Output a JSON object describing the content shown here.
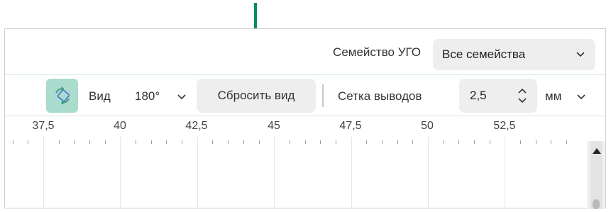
{
  "family": {
    "label": "Семейство УГО",
    "selected": "Все семейства"
  },
  "toolbar": {
    "rotate_icon": "rotate-icon",
    "view_label": "Вид",
    "view_angle": "180°",
    "reset_view_label": "Сбросить вид",
    "pin_grid_label": "Сетка выводов",
    "pin_grid_value": "2,5",
    "unit": "мм"
  },
  "ruler": {
    "labels": [
      "37,5",
      "40",
      "42,5",
      "45",
      "47,5",
      "50",
      "52,5"
    ]
  },
  "annotation": {
    "arrow_color": "#0a8a68"
  },
  "colors": {
    "accent": "#a9dccd",
    "arrow": "#0a8a68"
  }
}
